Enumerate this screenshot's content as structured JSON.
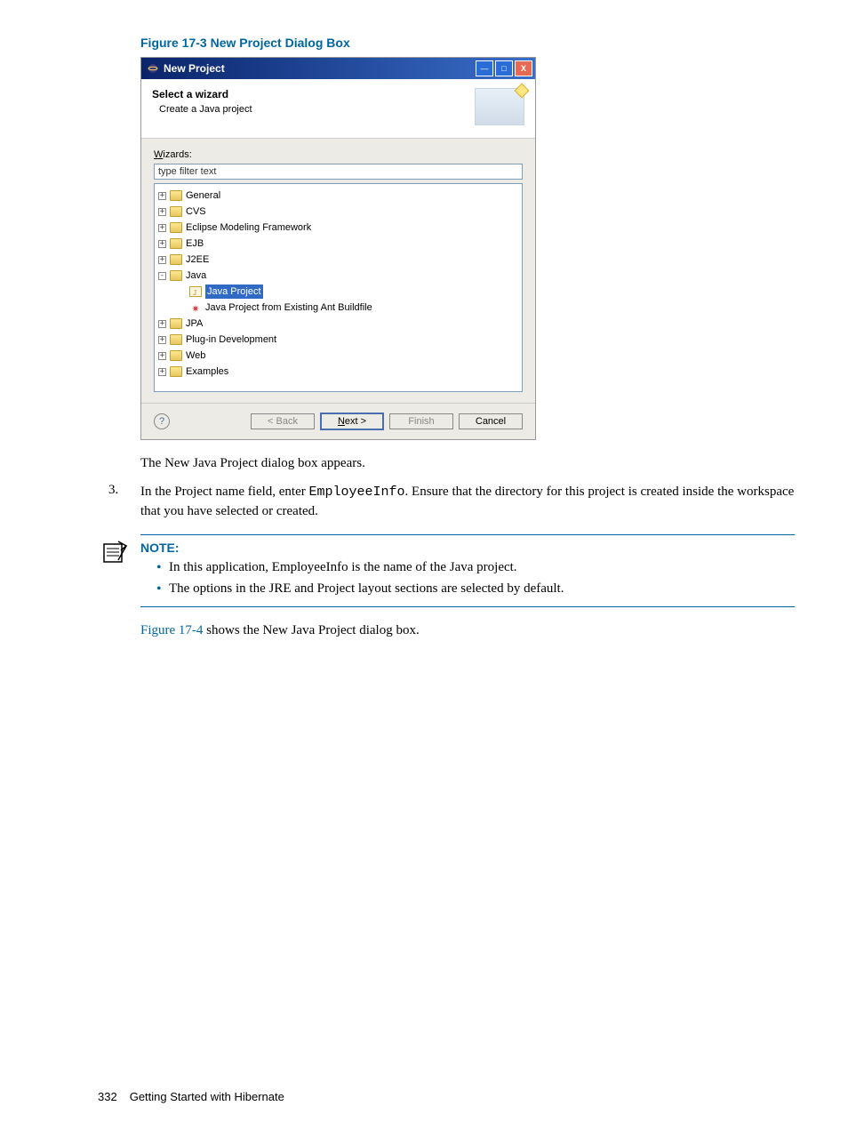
{
  "figure": {
    "caption": "Figure 17-3 New Project Dialog Box"
  },
  "dialog": {
    "title": "New Project",
    "wizard_title": "Select a wizard",
    "wizard_subtitle": "Create a Java project",
    "wizards_label_prefix": "W",
    "wizards_label_rest": "izards:",
    "filter_placeholder": "type filter text",
    "tree": {
      "general": "General",
      "cvs": "CVS",
      "emf": "Eclipse Modeling Framework",
      "ejb": "EJB",
      "j2ee": "J2EE",
      "java": "Java",
      "java_project": "Java Project",
      "java_ant": "Java Project from Existing Ant Buildfile",
      "jpa": "JPA",
      "plugin": "Plug-in Development",
      "web": "Web",
      "examples": "Examples"
    },
    "buttons": {
      "back": "< Back",
      "next": "Next >",
      "finish": "Finish",
      "cancel": "Cancel"
    }
  },
  "body_text": {
    "after_figure": "The New Java Project dialog box appears.",
    "step3_num": "3.",
    "step3_a": "In the Project name field, enter ",
    "step3_b": "EmployeeInfo",
    "step3_c": ". Ensure that the directory for this project is created inside the workspace that you have selected or created.",
    "note_title": "NOTE:",
    "note1": "In this application, EmployeeInfo is the name of the Java project.",
    "note2": "The options in the JRE and Project layout sections are selected by default.",
    "fig_ref": "Figure 17-4",
    "fig_ref_rest": " shows the New Java Project dialog box."
  },
  "footer": {
    "page": "332",
    "chapter": "Getting Started with Hibernate"
  }
}
